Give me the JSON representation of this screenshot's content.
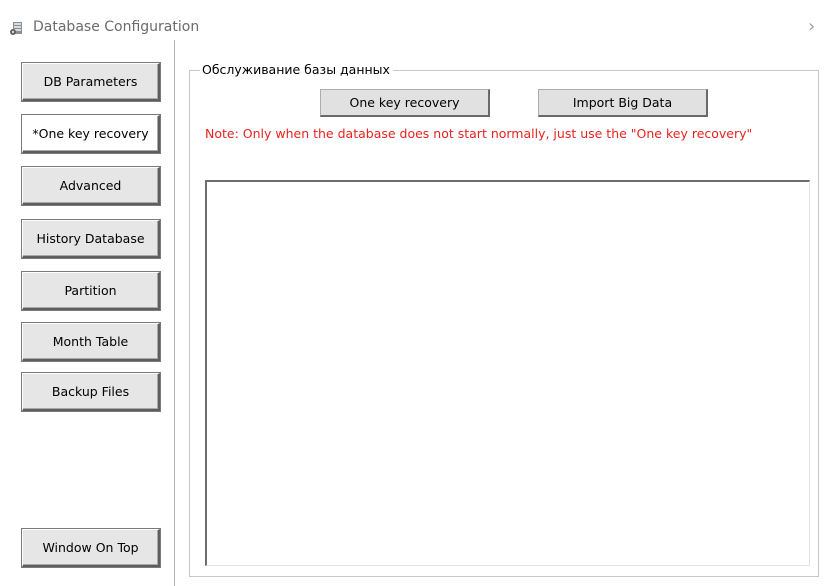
{
  "window": {
    "title": "Database Configuration",
    "icon": "database-config-icon",
    "chevron": "›"
  },
  "sidebar": {
    "items": [
      {
        "label": "DB Parameters",
        "active": false
      },
      {
        "label": "*One key recovery",
        "active": true
      },
      {
        "label": "Advanced",
        "active": false
      },
      {
        "label": "History Database",
        "active": false
      },
      {
        "label": "Partition",
        "active": false
      },
      {
        "label": "Month Table",
        "active": false
      },
      {
        "label": "Backup Files",
        "active": false
      }
    ],
    "window_on_top_label": "Window On Top"
  },
  "main": {
    "group_title": "Обслуживание базы данных",
    "one_key_recovery_label": "One key recovery",
    "import_big_data_label": "Import Big Data",
    "note": "Note: Only when the database does not start normally, just use the \"One key recovery\"",
    "note_color": "#e8231f",
    "log_text": ""
  }
}
